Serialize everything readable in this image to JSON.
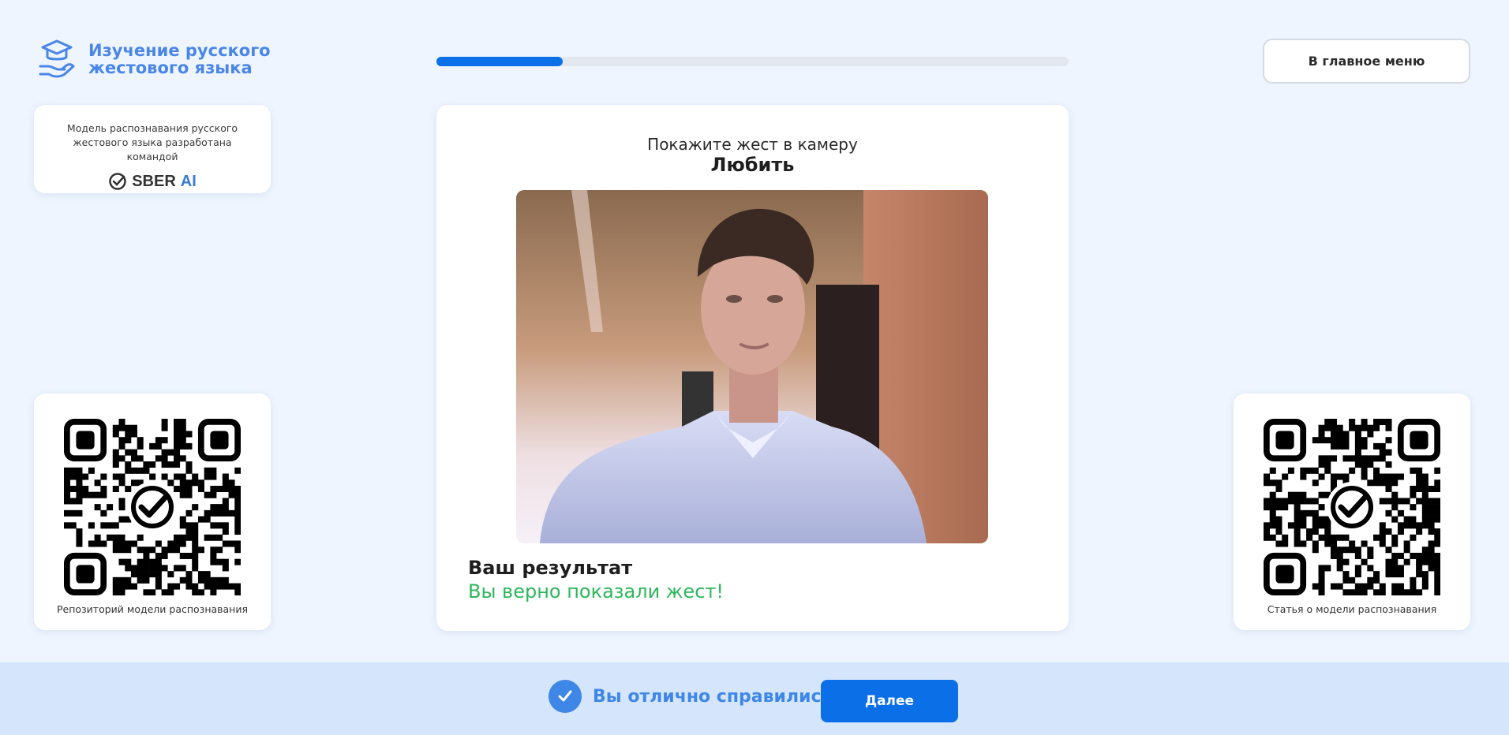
{
  "app": {
    "title_line1": "Изучение русского",
    "title_line2": "жестового языка",
    "logo_icon": "graduation-cap-hand-icon",
    "accent_color": "#4a86e8"
  },
  "progress": {
    "fraction": 0.2,
    "color": "#0b6fe8"
  },
  "header": {
    "menu_button_label": "В главное меню"
  },
  "credits": {
    "text": "Модель распознавания русского жестового языка разработана командой",
    "brand": "SBER",
    "brand_suffix": "AI"
  },
  "qr_left": {
    "caption": "Репозиторий модели распознавания"
  },
  "qr_right": {
    "caption": "Статья о модели распознавания"
  },
  "exercise": {
    "instruction": "Покажите жест в камеру",
    "gesture": "Любить",
    "result_title": "Ваш результат",
    "result_text": "Вы верно показали жест!",
    "success_color": "#2cb75a"
  },
  "footer": {
    "message": "Вы отлично справились!",
    "next_button_label": "Далее"
  }
}
